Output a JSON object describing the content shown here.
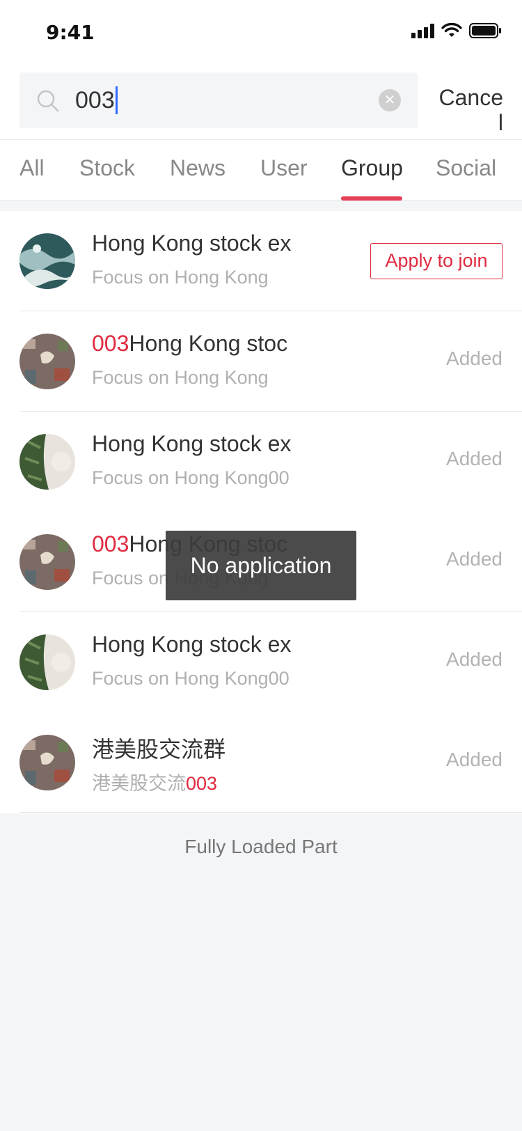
{
  "status_bar": {
    "time": "9:41"
  },
  "search": {
    "value": "003",
    "cancel_label": "Cancel"
  },
  "tabs": [
    {
      "label": "All",
      "active": false
    },
    {
      "label": "Stock",
      "active": false
    },
    {
      "label": "News",
      "active": false
    },
    {
      "label": "User",
      "active": false
    },
    {
      "label": "Group",
      "active": true
    },
    {
      "label": "Social",
      "active": false
    }
  ],
  "groups": [
    {
      "title_hl": "",
      "title": "Hong Kong stock ex",
      "subtitle": "Focus on Hong Kong",
      "subtitle_hl": "",
      "action": "Apply to join",
      "avatar_icon": "ocean-waves-image"
    },
    {
      "title_hl": "003",
      "title": "Hong Kong stoc",
      "subtitle": "Focus on Hong Kong",
      "subtitle_hl": "",
      "action": "Added",
      "avatar_icon": "city-aerial-image"
    },
    {
      "title_hl": "",
      "title": "Hong Kong stock ex",
      "subtitle": "Focus on Hong Kong00",
      "subtitle_hl": "",
      "action": "Added",
      "avatar_icon": "beach-palms-image"
    },
    {
      "title_hl": "003",
      "title": "Hong Kong stoc",
      "subtitle": "Focus on Hong Kong",
      "subtitle_hl": "",
      "action": "Added",
      "avatar_icon": "city-aerial-image"
    },
    {
      "title_hl": "",
      "title": "Hong Kong stock ex",
      "subtitle": "Focus on Hong Kong00",
      "subtitle_hl": "",
      "action": "Added",
      "avatar_icon": "beach-palms-image"
    },
    {
      "title_hl": "",
      "title": "港美股交流群",
      "subtitle": "港美股交流",
      "subtitle_hl": "003",
      "action": "Added",
      "avatar_icon": "city-aerial-image"
    }
  ],
  "footer": {
    "text": "Fully Loaded Part"
  },
  "toast": {
    "text": "No application"
  },
  "colors": {
    "accent": "#e02a3f",
    "tab_underline": "#e53e57",
    "caret": "#2f6bff"
  }
}
